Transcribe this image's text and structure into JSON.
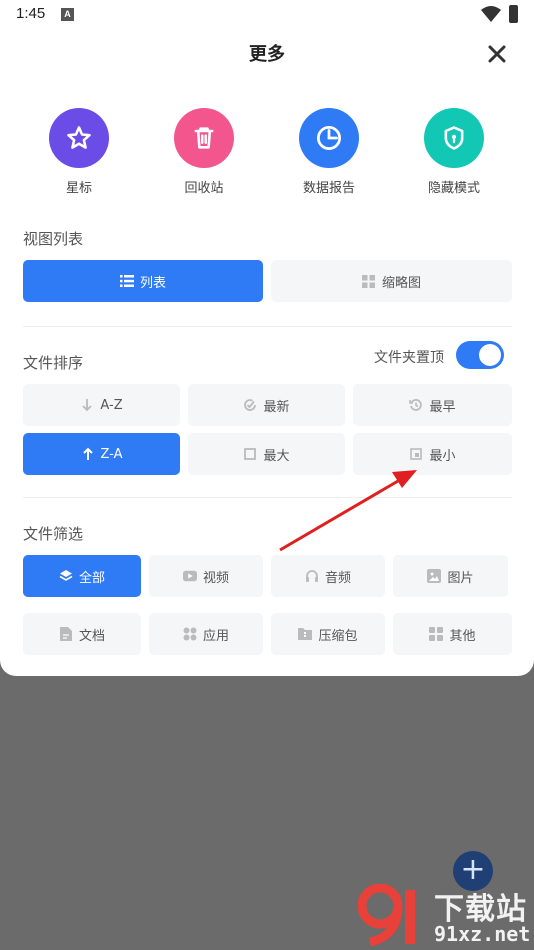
{
  "status_bar": {
    "time": "1:45",
    "notification_icon": "A",
    "wifi_icon": "wifi-icon",
    "battery_icon": "battery-icon"
  },
  "sheet": {
    "title": "更多",
    "close_icon": "close-icon"
  },
  "quick_actions": [
    {
      "label": "星标",
      "icon": "star-icon",
      "color": "#6b4ce6"
    },
    {
      "label": "回收站",
      "icon": "trash-icon",
      "color": "#f2568c"
    },
    {
      "label": "数据报告",
      "icon": "pie-chart-icon",
      "color": "#2f7af5"
    },
    {
      "label": "隐藏模式",
      "icon": "shield-lock-icon",
      "color": "#12c7b4"
    }
  ],
  "view_list": {
    "heading": "视图列表",
    "options": [
      {
        "label": "列表",
        "icon": "list-icon",
        "selected": true
      },
      {
        "label": "缩略图",
        "icon": "grid-icon",
        "selected": false
      }
    ]
  },
  "file_sort": {
    "heading": "文件排序",
    "pin_folders_label": "文件夹置顶",
    "pin_folders_on": true,
    "options": [
      {
        "label": "A-Z",
        "icon": "arrow-down-icon",
        "selected": false
      },
      {
        "label": "最新",
        "icon": "clock-check-icon",
        "selected": false
      },
      {
        "label": "最早",
        "icon": "history-icon",
        "selected": false
      },
      {
        "label": "Z-A",
        "icon": "arrow-up-icon",
        "selected": true
      },
      {
        "label": "最大",
        "icon": "square-icon",
        "selected": false
      },
      {
        "label": "最小",
        "icon": "small-square-icon",
        "selected": false
      }
    ]
  },
  "file_filter": {
    "heading": "文件筛选",
    "options": [
      {
        "label": "全部",
        "icon": "layers-icon",
        "selected": true
      },
      {
        "label": "视频",
        "icon": "video-icon",
        "selected": false
      },
      {
        "label": "音频",
        "icon": "headphones-icon",
        "selected": false
      },
      {
        "label": "图片",
        "icon": "image-icon",
        "selected": false
      },
      {
        "label": "文档",
        "icon": "document-icon",
        "selected": false
      },
      {
        "label": "应用",
        "icon": "apps-icon",
        "selected": false
      },
      {
        "label": "压缩包",
        "icon": "archive-icon",
        "selected": false
      },
      {
        "label": "其他",
        "icon": "other-icon",
        "selected": false
      }
    ]
  },
  "accent_color": "#2f7af5",
  "fab": {
    "label": "+"
  },
  "watermark": {
    "brand": "下载站",
    "site": "91xz.net",
    "logo_text": "91"
  }
}
